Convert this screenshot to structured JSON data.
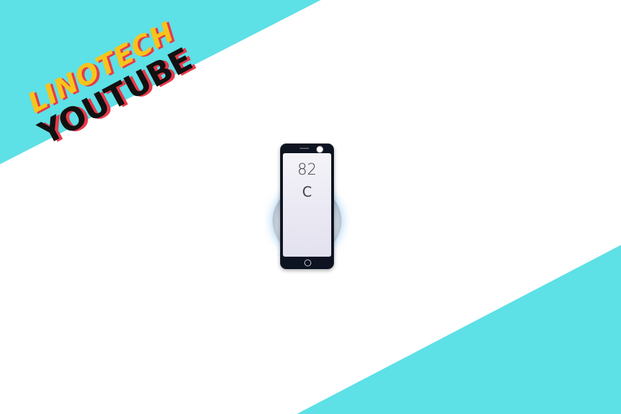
{
  "branding": {
    "line1": "LINOTECH",
    "line2": "YOUTUBE"
  },
  "phone_screen": {
    "time": "82",
    "date": "",
    "temp": "C"
  },
  "colors": {
    "accent": "#5de0e6",
    "background": "#ffffff",
    "logo_yellow": "#f4c51d",
    "logo_red": "#e8394a",
    "logo_black": "#111111"
  },
  "icons": [
    "wireless-charger-icon",
    "smartphone-icon"
  ]
}
